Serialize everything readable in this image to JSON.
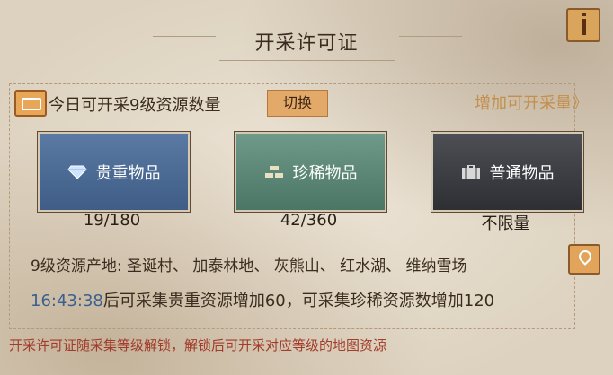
{
  "dialog": {
    "title": "开采许可证"
  },
  "header": {
    "label": "今日可开采9级资源数量",
    "switch_label": "切换",
    "increase_link": "增加可开采量》"
  },
  "cards": [
    {
      "name": "贵重物品",
      "count": "19/180",
      "icon": "diamond-icon",
      "color": "#4a6a95"
    },
    {
      "name": "珍稀物品",
      "count": "42/360",
      "icon": "gold-bars-icon",
      "color": "#5d8878"
    },
    {
      "name": "普通物品",
      "count": "不限量",
      "icon": "chest-icon",
      "color": "#3c3d42"
    }
  ],
  "source": {
    "text": "9级资源产地: 圣诞村、 加泰林地、 灰熊山、 红水湖、 维纳雪场"
  },
  "timer": {
    "time": "16:43:38",
    "text": "后可采集贵重资源增加60，可采集珍稀资源数增加120"
  },
  "footer": {
    "note": "开采许可证随采集等级解锁，解锁后可开采对应等级的地图资源"
  }
}
